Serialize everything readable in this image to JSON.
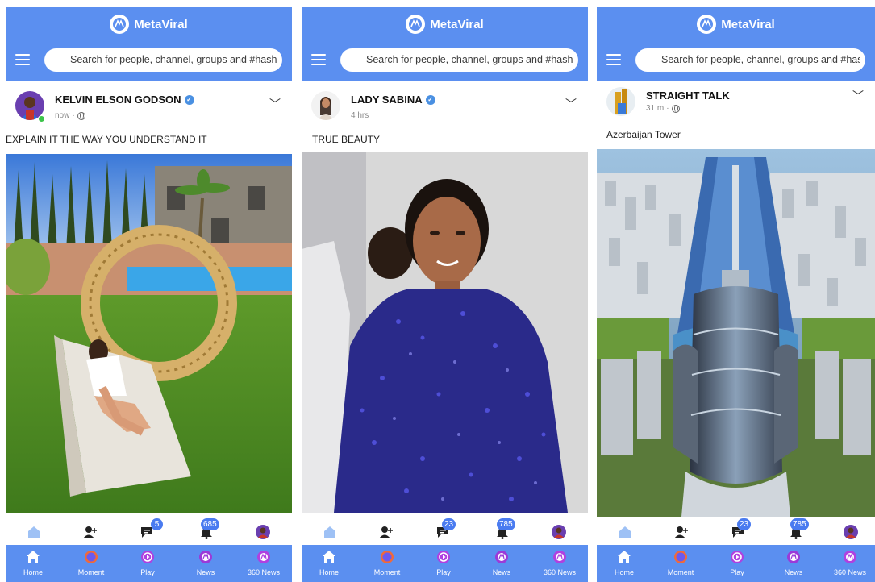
{
  "screens": [
    {
      "app_name": "MetaViral",
      "search_placeholder": "Search for people, channel, groups and #hashta",
      "author": "KELVIN ELSON GODSON",
      "time": "now",
      "caption": "EXPLAIN IT THE WAY YOU UNDERSTAND IT",
      "messages_badge": "5",
      "notifications_badge": "685",
      "nav": [
        "Home",
        "Moment",
        "Play",
        "News",
        "360 News"
      ]
    },
    {
      "app_name": "MetaViral",
      "search_placeholder": "Search for people, channel, groups and #hashta",
      "author": "LADY SABINA",
      "time": "4 hrs",
      "caption": "TRUE BEAUTY",
      "messages_badge": "23",
      "notifications_badge": "785",
      "nav": [
        "Home",
        "Moment",
        "Play",
        "News",
        "360 News"
      ]
    },
    {
      "app_name": "MetaViral",
      "search_placeholder": "Search for people, channel, groups and #hashta",
      "author": "STRAIGHT TALK",
      "time": "31 m",
      "caption": "Azerbaijan Tower",
      "messages_badge": "23",
      "notifications_badge": "785",
      "nav": [
        "Home",
        "Moment",
        "Play",
        "News",
        "360 News"
      ]
    }
  ],
  "colors": {
    "brand_blue": "#5b8ff0",
    "badge_blue": "#4a7bf0",
    "verified_blue": "#4a90e2",
    "online_green": "#3cc44a",
    "play_purple": "#b040e0"
  },
  "icons": {
    "menu": "hamburger-icon",
    "search": "search-icon",
    "verified": "verified-badge-icon",
    "privacy": "globe-icon",
    "options": "chevron-down-icon",
    "home_feed": "home-icon",
    "friends": "add-friend-icon",
    "messages": "chat-icon",
    "notifications": "bell-icon",
    "profile": "avatar",
    "nav": [
      "home-icon",
      "moment-icon",
      "play-icon",
      "news-icon",
      "360-news-icon"
    ]
  }
}
